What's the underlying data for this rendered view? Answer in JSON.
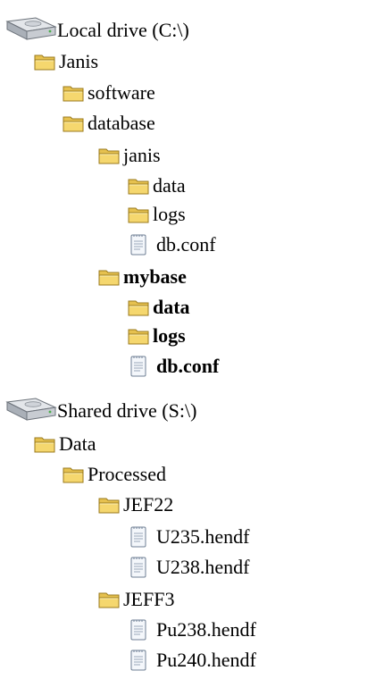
{
  "tree": [
    {
      "type": "drive",
      "label": "Local drive (C:\\)",
      "bold": false,
      "icon": "drive-icon"
    },
    {
      "type": "folder",
      "label": "Janis",
      "bold": false,
      "icon": "folder-icon"
    },
    {
      "type": "folder",
      "label": "software",
      "bold": false,
      "icon": "folder-icon"
    },
    {
      "type": "folder",
      "label": "database",
      "bold": false,
      "icon": "folder-icon"
    },
    {
      "type": "folder",
      "label": "janis",
      "bold": false,
      "icon": "folder-icon"
    },
    {
      "type": "folder",
      "label": "data",
      "bold": false,
      "icon": "folder-icon"
    },
    {
      "type": "folder",
      "label": "logs",
      "bold": false,
      "icon": "folder-icon"
    },
    {
      "type": "file",
      "label": "db.conf",
      "bold": false,
      "icon": "file-icon"
    },
    {
      "type": "folder",
      "label": "mybase",
      "bold": true,
      "icon": "folder-icon"
    },
    {
      "type": "folder",
      "label": "data",
      "bold": true,
      "icon": "folder-icon"
    },
    {
      "type": "folder",
      "label": "logs",
      "bold": true,
      "icon": "folder-icon"
    },
    {
      "type": "file",
      "label": "db.conf",
      "bold": true,
      "icon": "file-icon"
    },
    {
      "type": "drive",
      "label": "Shared drive (S:\\)",
      "bold": false,
      "icon": "drive-icon"
    },
    {
      "type": "folder",
      "label": "Data",
      "bold": false,
      "icon": "folder-icon"
    },
    {
      "type": "folder",
      "label": "Processed",
      "bold": false,
      "icon": "folder-icon"
    },
    {
      "type": "folder",
      "label": "JEF22",
      "bold": false,
      "icon": "folder-icon"
    },
    {
      "type": "file",
      "label": "U235.hendf",
      "bold": false,
      "icon": "file-icon"
    },
    {
      "type": "file",
      "label": "U238.hendf",
      "bold": false,
      "icon": "file-icon"
    },
    {
      "type": "folder",
      "label": "JEFF3",
      "bold": false,
      "icon": "folder-icon"
    },
    {
      "type": "file",
      "label": "Pu238.hendf",
      "bold": false,
      "icon": "file-icon"
    },
    {
      "type": "file",
      "label": "Pu240.hendf",
      "bold": false,
      "icon": "file-icon"
    }
  ],
  "colors": {
    "folder_fill": "#f5d76e",
    "folder_light": "#fbe9a6",
    "folder_edge": "#9a7a1c",
    "drive_body": "#c8ccd2",
    "drive_edge": "#6d737b",
    "file_fill": "#f4f7fb",
    "file_edge": "#6f7f94"
  }
}
